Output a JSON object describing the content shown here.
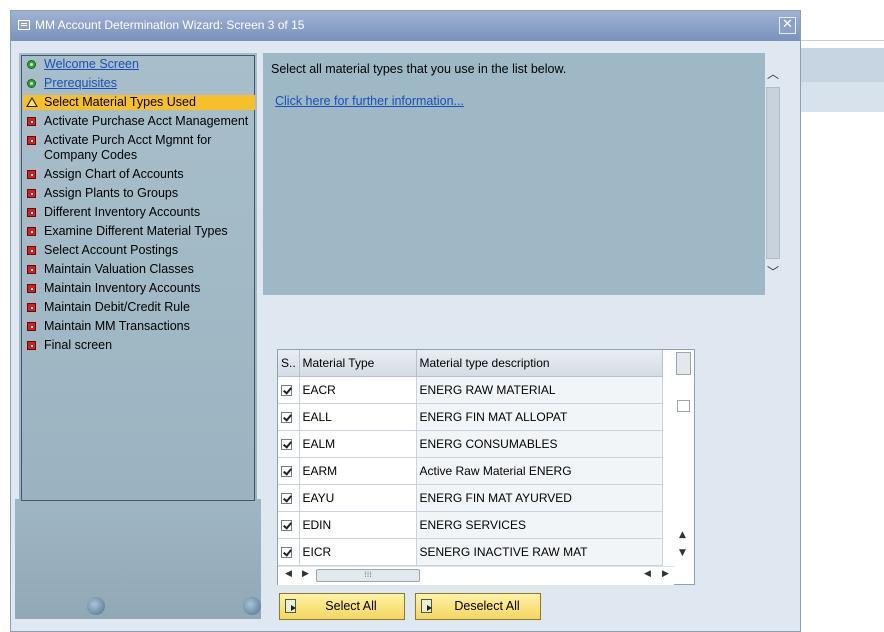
{
  "window": {
    "title": "MM Account Determination Wizard: Screen 3 of 15",
    "close_symbol": "✕"
  },
  "nav": {
    "items": [
      {
        "label": "Welcome Screen",
        "status": "done",
        "icon": "green-circle-icon",
        "link": true
      },
      {
        "label": "Prerequisites",
        "status": "done",
        "icon": "green-circle-icon",
        "link": true
      },
      {
        "label": "Select Material Types Used",
        "status": "current",
        "icon": "warning-icon",
        "link": false
      },
      {
        "label": "Activate Purchase Acct Management",
        "status": "pending",
        "icon": "red-square-icon",
        "link": false
      },
      {
        "label": "Activate Purch Acct Mgmnt for Company Codes",
        "status": "pending",
        "icon": "red-square-icon",
        "link": false
      },
      {
        "label": "Assign Chart of Accounts",
        "status": "pending",
        "icon": "red-square-icon",
        "link": false
      },
      {
        "label": "Assign Plants to Groups",
        "status": "pending",
        "icon": "red-square-icon",
        "link": false
      },
      {
        "label": "Different Inventory Accounts",
        "status": "pending",
        "icon": "red-square-icon",
        "link": false
      },
      {
        "label": "Examine Different Material Types",
        "status": "pending",
        "icon": "red-square-icon",
        "link": false
      },
      {
        "label": "Select Account Postings",
        "status": "pending",
        "icon": "red-square-icon",
        "link": false
      },
      {
        "label": "Maintain Valuation Classes",
        "status": "pending",
        "icon": "red-square-icon",
        "link": false
      },
      {
        "label": "Maintain Inventory Accounts",
        "status": "pending",
        "icon": "red-square-icon",
        "link": false
      },
      {
        "label": "Maintain Debit/Credit Rule",
        "status": "pending",
        "icon": "red-square-icon",
        "link": false
      },
      {
        "label": "Maintain MM Transactions",
        "status": "pending",
        "icon": "red-square-icon",
        "link": false
      },
      {
        "label": "Final screen",
        "status": "pending",
        "icon": "red-square-icon",
        "link": false
      }
    ]
  },
  "info": {
    "text": "Select all material types that you use in the list below.",
    "link": "Click here for further information..."
  },
  "table": {
    "columns": [
      "S..",
      "Material Type",
      "Material type description"
    ],
    "rows": [
      {
        "selected": true,
        "type": "EACR",
        "desc": "ENERG RAW MATERIAL"
      },
      {
        "selected": true,
        "type": "EALL",
        "desc": "ENERG FIN MAT ALLOPAT"
      },
      {
        "selected": true,
        "type": "EALM",
        "desc": "ENERG CONSUMABLES"
      },
      {
        "selected": true,
        "type": "EARM",
        "desc": "Active Raw Material ENERG"
      },
      {
        "selected": true,
        "type": "EAYU",
        "desc": "ENERG FIN MAT AYURVED"
      },
      {
        "selected": true,
        "type": "EDIN",
        "desc": "ENERG SERVICES"
      },
      {
        "selected": true,
        "type": "EICR",
        "desc": "SENERG INACTIVE RAW MAT"
      }
    ]
  },
  "buttons": {
    "select_all": "Select All",
    "deselect_all": "Deselect All"
  },
  "colors": {
    "selected_step": "#f7c02a",
    "button": "#f4d660",
    "title_bar": "#7991bc"
  }
}
